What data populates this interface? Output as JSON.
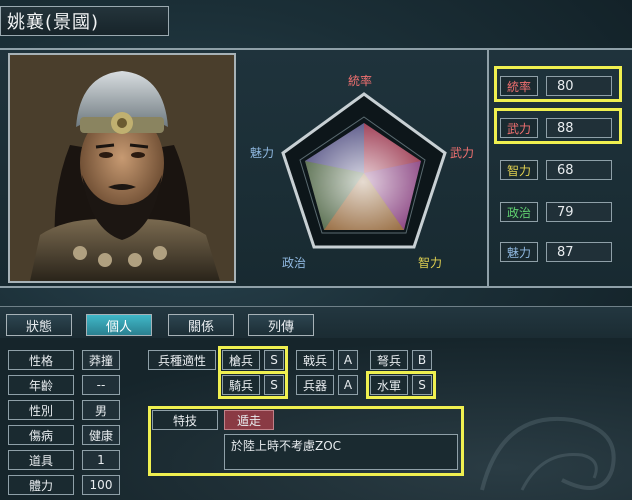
{
  "title": "姚襄(景國)",
  "radar": {
    "top": "統率",
    "right": "武力",
    "bottom_right": "智力",
    "bottom_left": "政治",
    "left": "魅力"
  },
  "stats": [
    {
      "label": "統率",
      "value": "80",
      "color": "#f07070"
    },
    {
      "label": "武力",
      "value": "88",
      "color": "#f07070"
    },
    {
      "label": "智力",
      "value": "68",
      "color": "#e0d050"
    },
    {
      "label": "政治",
      "value": "79",
      "color": "#60d070"
    },
    {
      "label": "魅力",
      "value": "87",
      "color": "#8fb8e0"
    }
  ],
  "tabs": [
    "狀態",
    "個人",
    "關係",
    "列傳"
  ],
  "personal": [
    {
      "label": "性格",
      "value": "莽撞"
    },
    {
      "label": "年齡",
      "value": "--"
    },
    {
      "label": "性別",
      "value": "男"
    },
    {
      "label": "傷病",
      "value": "健康"
    },
    {
      "label": "道具",
      "value": "1"
    },
    {
      "label": "體力",
      "value": "100"
    }
  ],
  "aptitude": {
    "header": "兵種適性",
    "row1": [
      {
        "label": "槍兵",
        "grade": "S"
      },
      {
        "label": "戟兵",
        "grade": "A"
      },
      {
        "label": "弩兵",
        "grade": "B"
      }
    ],
    "row2": [
      {
        "label": "騎兵",
        "grade": "S"
      },
      {
        "label": "兵器",
        "grade": "A"
      },
      {
        "label": "水軍",
        "grade": "S"
      }
    ]
  },
  "skill": {
    "label": "特技",
    "name": "遁走",
    "description": "於陸上時不考慮ZOC"
  },
  "colors": {
    "highlight": "#f0f050",
    "active_tab": "#40b8c8"
  }
}
